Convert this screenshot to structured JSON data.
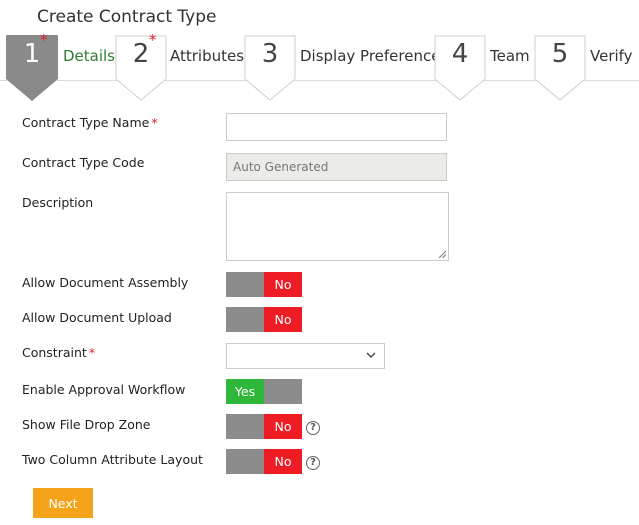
{
  "page_title": "Create Contract Type",
  "steps": [
    {
      "number": "1",
      "label": "Details",
      "required": "*",
      "active": true
    },
    {
      "number": "2",
      "label": "Attributes",
      "required": "*",
      "active": false
    },
    {
      "number": "3",
      "label": "Display Preference",
      "required": "",
      "active": false
    },
    {
      "number": "4",
      "label": "Team",
      "required": "",
      "active": false
    },
    {
      "number": "5",
      "label": "Verify",
      "required": "",
      "active": false
    }
  ],
  "form": {
    "contract_type_name": {
      "label": "Contract Type Name",
      "required": "*",
      "value": ""
    },
    "contract_type_code": {
      "label": "Contract Type Code",
      "value": "Auto Generated"
    },
    "description": {
      "label": "Description",
      "value": ""
    },
    "allow_document_assembly": {
      "label": "Allow Document Assembly",
      "state": "No"
    },
    "allow_document_upload": {
      "label": "Allow Document Upload",
      "state": "No"
    },
    "constraint": {
      "label": "Constraint",
      "required": "*",
      "selected": ""
    },
    "enable_approval_workflow": {
      "label": "Enable Approval Workflow",
      "state": "Yes"
    },
    "show_file_drop_zone": {
      "label": "Show File Drop Zone",
      "state": "No",
      "help": "?"
    },
    "two_column_attribute_layout": {
      "label": "Two Column Attribute Layout",
      "state": "No",
      "help": "?"
    }
  },
  "next_button": "Next",
  "colors": {
    "active_step": "#8a8a8a",
    "toggle_no": "#ee1c25",
    "toggle_yes": "#2fb73a",
    "next": "#f5a31a",
    "required": "#e0212b"
  }
}
